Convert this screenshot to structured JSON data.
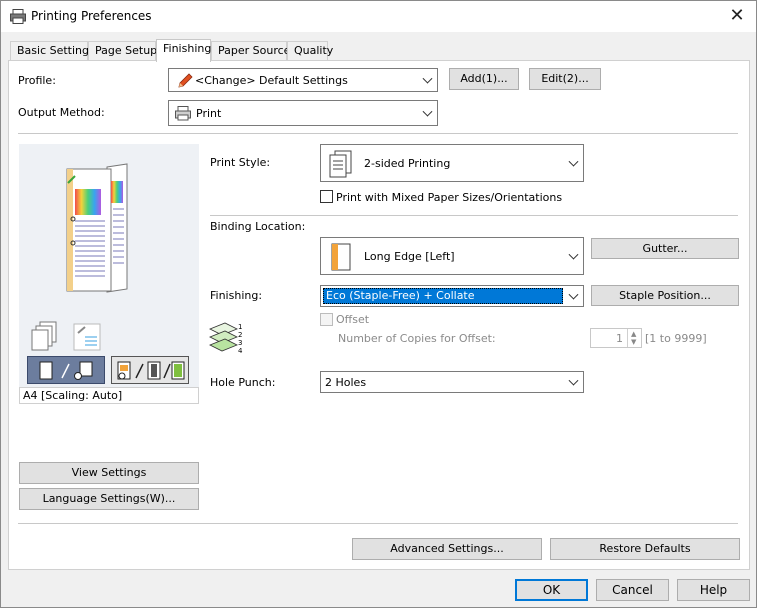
{
  "window": {
    "title": "Printing Preferences"
  },
  "tabs": [
    "Basic Settings",
    "Page Setup",
    "Finishing",
    "Paper Source",
    "Quality"
  ],
  "profile": {
    "label": "Profile:",
    "value": "<Change> Default Settings",
    "add": "Add(1)...",
    "edit": "Edit(2)..."
  },
  "output_method": {
    "label": "Output Method:",
    "value": "Print"
  },
  "print_style": {
    "label": "Print Style:",
    "value": "2-sided Printing",
    "mixed_label": "Print with Mixed Paper Sizes/Orientations"
  },
  "binding": {
    "label": "Binding Location:",
    "value": "Long Edge [Left]",
    "gutter": "Gutter..."
  },
  "finishing": {
    "label": "Finishing:",
    "value": "Eco (Staple-Free) + Collate",
    "staple_position": "Staple Position..."
  },
  "offset": {
    "label": "Offset",
    "copies_label": "Number of Copies for Offset:",
    "copies_value": "1",
    "range": "[1 to 9999]"
  },
  "hole_punch": {
    "label": "Hole Punch:",
    "value": "2 Holes"
  },
  "preview": {
    "caption": "A4 [Scaling: Auto]"
  },
  "left_buttons": {
    "view": "View Settings",
    "language": "Language Settings(W)..."
  },
  "bottom_buttons": {
    "advanced": "Advanced Settings...",
    "restore": "Restore Defaults"
  },
  "footer": {
    "ok": "OK",
    "cancel": "Cancel",
    "help": "Help"
  },
  "colors": {
    "accent": "#0078d7",
    "panel": "#ffffff",
    "window_bg": "#f0f0f0"
  }
}
